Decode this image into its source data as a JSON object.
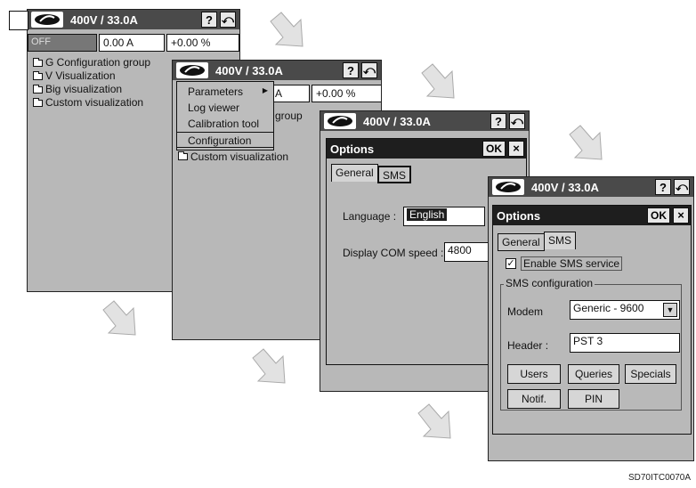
{
  "title": "400V / 33.0A",
  "help_label": "?",
  "exit_label": "⤺",
  "screen1": {
    "status": "OFF",
    "current": "0.00 A",
    "percent": "+0.00 %",
    "tree": [
      "G Configuration group",
      "V Visualization",
      "Big visualization",
      "Custom visualization"
    ]
  },
  "screen2": {
    "field_partial": "A",
    "percent": "+0.00 %",
    "tree_partial": "group",
    "tree_last": "Custom visualization",
    "menu": [
      "Parameters",
      "Log viewer",
      "Calibration tool",
      "Configuration"
    ],
    "selected_menu": "Configuration"
  },
  "screen3": {
    "dialog_title": "Options",
    "ok": "OK",
    "close": "×",
    "tabs": [
      "General",
      "SMS"
    ],
    "language_label": "Language :",
    "language_value": "English",
    "com_label": "Display COM speed :",
    "com_value": "4800"
  },
  "screen4": {
    "dialog_title": "Options",
    "ok": "OK",
    "close": "×",
    "tabs": [
      "General",
      "SMS"
    ],
    "enable_label": "Enable SMS service",
    "enable_checked": "✓",
    "group_label": "SMS configuration",
    "modem_label": "Modem",
    "modem_value": "Generic - 9600",
    "header_label": "Header :",
    "header_value": "PST 3",
    "buttons": [
      "Users",
      "Queries",
      "Specials",
      "Notif.",
      "PIN"
    ]
  },
  "caption": "SD70ITC0070A",
  "colors": {
    "titlebar": "#4a4a4a",
    "dialog_titlebar": "#1e1e1e",
    "screen_bg": "#b8b8b8",
    "arrow": "#e2e2e2"
  },
  "icons": [
    "logo-icon",
    "help-icon",
    "exit-icon",
    "folder-icon",
    "arrow-icon",
    "dropdown-arrow-icon",
    "checkmark-icon"
  ]
}
